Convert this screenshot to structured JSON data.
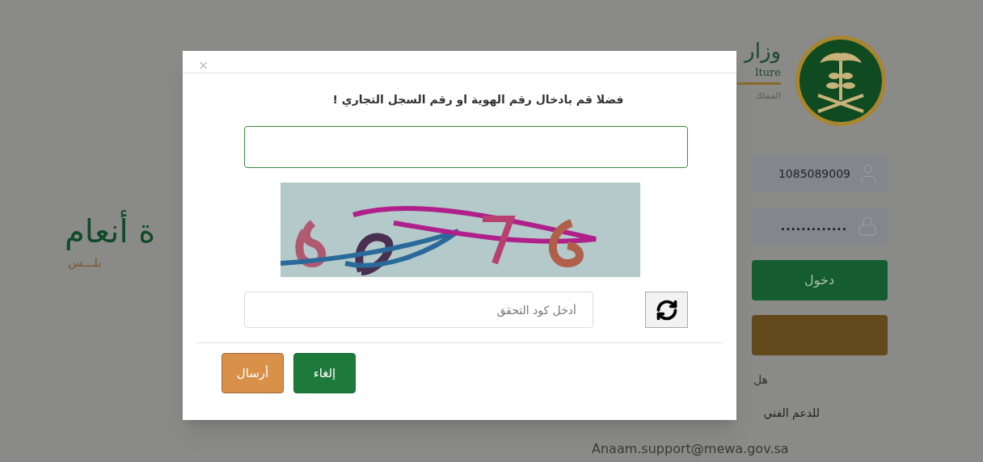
{
  "background": {
    "ministry_title": "وزار",
    "ministry_subtitle_en": "lture",
    "ministry_subtitle_ar": "المملك",
    "brand_title": "ة أنعام",
    "brand_tagline": "بلـــس",
    "login": {
      "username": "1085089009",
      "password": ".............",
      "login_button": "دخول"
    },
    "help_text": "هل",
    "support_text": "للدعم الفني",
    "support_email": "Anaam.support@mewa.gov.sa"
  },
  "dialog": {
    "close": "×",
    "message": "فضلا قم بادخال رقم الهوية او رقم السجل التجاري !",
    "captcha_input": {
      "placeholder": "أدخل كود التحقق"
    },
    "buttons": [
      {
        "label": "إلغاء",
        "kind": "primary"
      },
      {
        "label": "أرسال",
        "kind": "secondary"
      }
    ]
  }
}
